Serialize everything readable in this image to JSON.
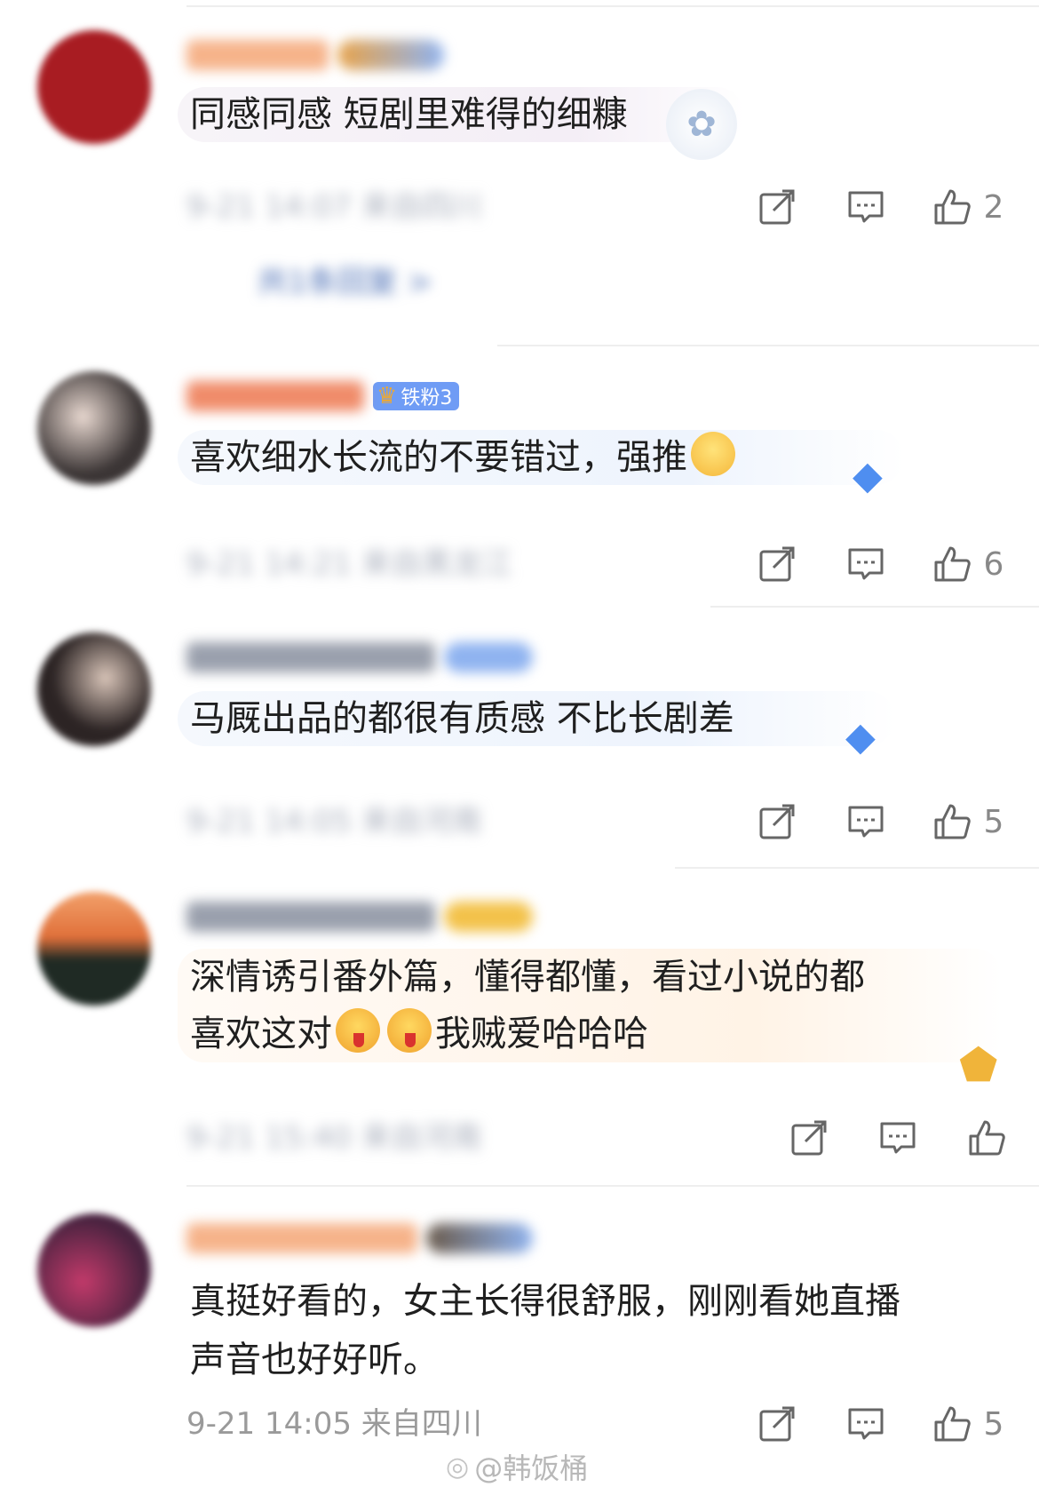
{
  "comments": [
    {
      "id": "c1",
      "text": "同感同感 短剧里难得的细糠",
      "bubble": "pink",
      "avatar_color": "#a81c22",
      "name_color": "#f6b38a",
      "like_count": "2",
      "time_location": "9-21 14:07 来自四川",
      "meta_blurred": true,
      "replies_label": "共1条回复 >"
    },
    {
      "id": "c2",
      "text": "喜欢细水长流的不要错过，强推",
      "bubble": "blue",
      "badge_label": "铁粉3",
      "avatar_color": "#3b3535",
      "name_color": "#f08c6a",
      "like_count": "6",
      "time_location": "9-21 14:21 来自黑龙江",
      "meta_blurred": true
    },
    {
      "id": "c3",
      "text": "马厩出品的都很有质感 不比长剧差",
      "bubble": "blue",
      "avatar_color": "#2c2424",
      "name_color": "#9aa0ad",
      "like_count": "5",
      "time_location": "9-21 14:05 来自河南",
      "meta_blurred": true
    },
    {
      "id": "c4",
      "text_line1": "深情诱引番外篇，懂得都懂，看过小说的都",
      "text_line2a": "喜欢这对",
      "text_line2b": "我贼爱哈哈哈",
      "bubble": "gold",
      "avatar_color": "#1f2a24",
      "name_color": "#9aa0ad",
      "like_count": "",
      "time_location": "9-21 15:40 来自河南",
      "meta_blurred": true
    },
    {
      "id": "c5",
      "text_line1": "真挺好看的，女主长得很舒服，刚刚看她直播",
      "text_line2": "声音也好好听。",
      "avatar_color": "#4a2340",
      "name_color": "#f6b38a",
      "like_count": "5",
      "time_location": "9-21 14:05 来自四川",
      "meta_blurred": false
    }
  ],
  "watermark": "@韩饭桶",
  "icons": {
    "repost": "repost-icon",
    "comment": "comment-icon",
    "like": "like-icon",
    "weibo_logo": "weibo-logo-icon"
  }
}
